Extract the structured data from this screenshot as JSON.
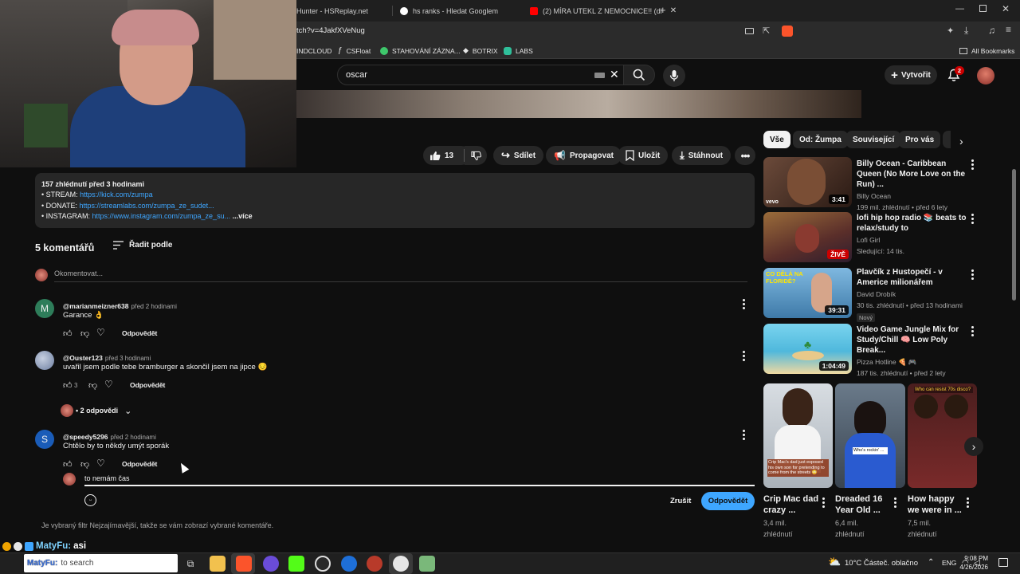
{
  "browser": {
    "tabs": [
      {
        "label": "Hunter - HSReplay.net"
      },
      {
        "label": "hs ranks - Hledat Googlem"
      },
      {
        "label": "(2) MÍRA UTEKL Z NEMOCNICE!! (dl"
      }
    ],
    "new_tab": "+",
    "url": "tch?v=4JakfXVeNug",
    "bookmarks": [
      "INDCLOUD",
      "CSFloat",
      "STAHOVÁNÍ ZÁZNA...",
      "BOTRIX",
      "LABS"
    ],
    "all_bookmarks": "All Bookmarks"
  },
  "yt": {
    "search_value": "oscar",
    "create_label": "Vytvořit",
    "notif_count": "2",
    "actions": {
      "likes": "13",
      "share": "Sdílet",
      "promote": "Propagovat",
      "save": "Uložit",
      "download": "Stáhnout"
    },
    "description": {
      "stats": "157 zhlédnutí  před 3 hodinami",
      "line1_label": "• STREAM: ",
      "line1_link": "https://kick.com/zumpa",
      "line2_label": "• DONATE: ",
      "line2_link": "https://streamlabs.com/zumpa_ze_sudet...",
      "line3_label": "• INSTAGRAM: ",
      "line3_link": "https://www.instagram.com/zumpa_ze_su...",
      "more": "...více"
    },
    "comments": {
      "count_label": "5 komentářů",
      "sort_label": "Řadit podle",
      "add_placeholder": "Okomentovat...",
      "reply_label": "Odpovědět",
      "items": [
        {
          "avatar_letter": "M",
          "channel": "@marianmeizner638",
          "time": "před 2 hodinami",
          "text": "Garance 👌"
        },
        {
          "avatar_letter": "",
          "channel": "@Ouster123",
          "time": "před 3 hodinami",
          "text": "uvařil jsem podle tebe bramburger a skončil jsem na jipce 😔",
          "likes": "3",
          "replies_label": "• 2 odpovědi"
        },
        {
          "avatar_letter": "S",
          "channel": "@speedy5296",
          "time": "před 2 hodinami",
          "text": "Chtělo by to někdy umýt sporák"
        }
      ],
      "reply_draft": "to nemám čas",
      "cancel_label": "Zrušit",
      "submit_label": "Odpovědět",
      "filter_note": "Je vybraný filtr Nejzajímavější, takže se vám zobrazí vybrané komentáře."
    },
    "chips": [
      "Vše",
      "Od: Žumpa",
      "Související",
      "Pro vás"
    ],
    "recommended": [
      {
        "title": "Billy Ocean - Caribbean Queen (No More Love on the Run) ...",
        "channel": "Billy Ocean",
        "meta": "199 mil. zhlédnutí • před 6 lety",
        "duration": "3:41",
        "badge": "vevo",
        "thumb_color": "#3a2a22"
      },
      {
        "title": "lofi hip hop radio 📚 beats to relax/study to",
        "channel": "Lofi Girl",
        "meta": "Sledující: 14 tis.",
        "duration": "ŽIVĚ",
        "thumb_color": "#6a3d2a"
      },
      {
        "title": "Plavčík z Hustopečí - v Americe milionářem",
        "channel": "David Drobík",
        "meta": "30 tis. zhlédnutí • před 13 hodinami",
        "tag": "Nový",
        "duration": "39:31",
        "overlay": "CO DĚLÁ NA FLORIDĚ?",
        "thumb_color": "#4a8ab8"
      },
      {
        "title": "Video Game Jungle Mix for Study/Chill 🧠 Low Poly Break...",
        "channel": "Pizza Hotline 🍕 🎮",
        "meta": "187 tis. zhlédnutí • před 2 lety",
        "duration": "1:04:49",
        "thumb_color": "#5fc7e0"
      }
    ],
    "shorts": [
      {
        "title": "Crip Mac dad crazy ...",
        "views": "3,4 mil. zhlédnutí",
        "caption": "Crip Mac's dad just exposed his own son for pretending to come from the streets 😳"
      },
      {
        "title": "Dreaded 16 Year Old ...",
        "views": "6,4 mil. zhlédnutí",
        "caption": "Who's rockin' ..."
      },
      {
        "title": "How happy we were in ...",
        "views": "7,5 mil. zhlédnutí",
        "caption": "Who can resist 70s disco?"
      }
    ]
  },
  "chat": {
    "user": "MatyFu:",
    "message": "asi"
  },
  "taskbar": {
    "search": "to search",
    "search_overlay": "MatyFu:",
    "weather": "10°C  Částeč. oblačno",
    "lang": "ENG",
    "time": "9:08 PM",
    "date": "4/26/2026"
  }
}
